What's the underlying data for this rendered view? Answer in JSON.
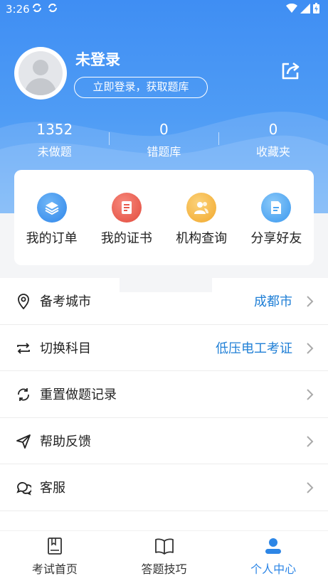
{
  "status_bar": {
    "time": "3:26"
  },
  "profile": {
    "name": "未登录",
    "login_button": "立即登录，获取题库"
  },
  "stats": [
    {
      "value": "1352",
      "label": "未做题"
    },
    {
      "value": "0",
      "label": "错题库"
    },
    {
      "value": "0",
      "label": "收藏夹"
    }
  ],
  "quick_actions": [
    {
      "label": "我的订单",
      "icon": "layers-icon",
      "color": "#3a93ee"
    },
    {
      "label": "我的证书",
      "icon": "certificate-icon",
      "color": "#ee5a4c"
    },
    {
      "label": "机构查询",
      "icon": "institution-icon",
      "color": "#f5b73d"
    },
    {
      "label": "分享好友",
      "icon": "share-doc-icon",
      "color": "#4aa4f2"
    }
  ],
  "menu": [
    {
      "label": "备考城市",
      "value": "成都市",
      "icon": "location-icon"
    },
    {
      "label": "切换科目",
      "value": "低压电工考证",
      "icon": "switch-icon"
    },
    {
      "label": "重置做题记录",
      "value": "",
      "icon": "reset-icon"
    },
    {
      "label": "帮助反馈",
      "value": "",
      "icon": "send-icon"
    },
    {
      "label": "客服",
      "value": "",
      "icon": "chat-icon"
    }
  ],
  "tabs": [
    {
      "label": "考试首页",
      "icon": "book-icon",
      "active": false
    },
    {
      "label": "答题技巧",
      "icon": "open-book-icon",
      "active": false
    },
    {
      "label": "个人中心",
      "icon": "person-icon",
      "active": true
    }
  ],
  "colors": {
    "primary": "#3f8ef3",
    "accent_text": "#1f7fd6",
    "active_tab": "#2d86e6"
  }
}
